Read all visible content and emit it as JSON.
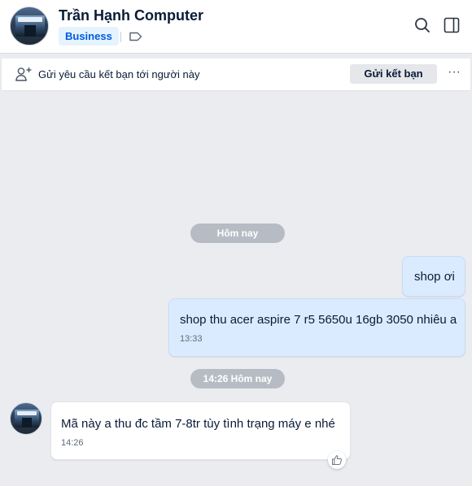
{
  "header": {
    "contact_name": "Trần Hạnh Computer",
    "badge": "Business",
    "icons": [
      "search-icon",
      "sidebar-panel-icon",
      "tag-icon"
    ]
  },
  "friend_request": {
    "text": "Gửi yêu cầu kết bạn tới người này",
    "button_label": "Gửi kết bạn",
    "more_label": "···"
  },
  "chat": {
    "date_separator_1": "Hôm nay",
    "messages": [
      {
        "sender": "me",
        "text": "shop ơi",
        "time": ""
      },
      {
        "sender": "me",
        "text": "shop thu acer aspire 7 r5 5650u 16gb 3050 nhiêu a",
        "time": "13:33"
      }
    ],
    "date_separator_2": "14:26 Hôm nay",
    "reply": {
      "sender": "them",
      "text": "Mã này a thu đc tầm 7-8tr tùy tình trạng máy e nhé",
      "time": "14:26"
    }
  },
  "colors": {
    "background": "#ebecf0",
    "my_bubble": "#dbebff",
    "their_bubble": "#ffffff",
    "badge_bg": "#e5f3ff",
    "badge_text": "#005ae0",
    "date_pill": "#b7bcc4"
  }
}
